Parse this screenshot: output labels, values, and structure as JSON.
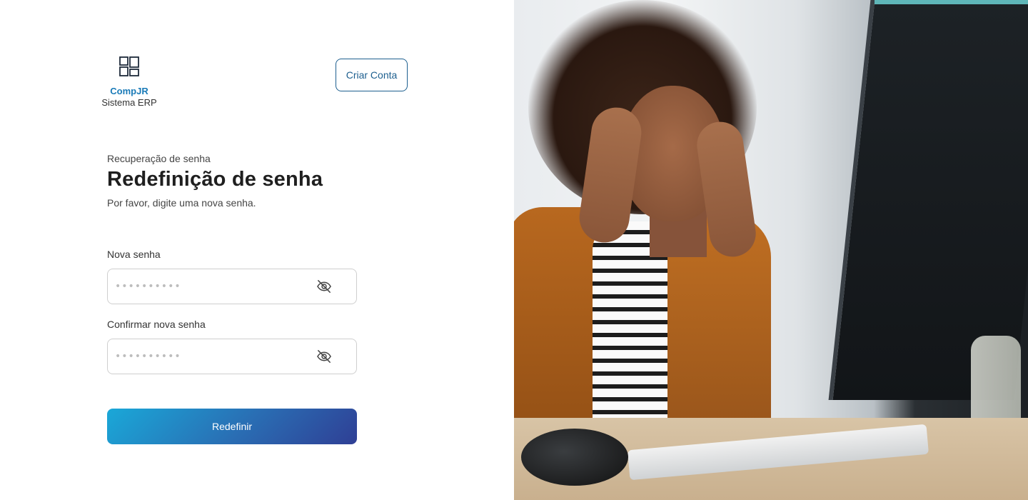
{
  "brand": {
    "name": "CompJR",
    "subtitle": "Sistema ERP",
    "icon": "layout-blocks-icon",
    "color": "#1a7bb8"
  },
  "header": {
    "create_account_label": "Criar Conta"
  },
  "form": {
    "eyebrow": "Recuperação de senha",
    "title": "Redefinição de senha",
    "subtitle": "Por favor, digite uma nova senha.",
    "new_password": {
      "label": "Nova senha",
      "placeholder": "••••••••••",
      "toggle_icon": "eye-off-icon"
    },
    "confirm_password": {
      "label": "Confirmar nova senha",
      "placeholder": "••••••••••",
      "toggle_icon": "eye-off-icon"
    },
    "submit_label": "Redefinir"
  },
  "colors": {
    "accent": "#1d5f8f",
    "button_gradient_start": "#1aa8d8",
    "button_gradient_end": "#2f3f95"
  },
  "hero_image": {
    "subject": "woman-at-computer-photo"
  }
}
